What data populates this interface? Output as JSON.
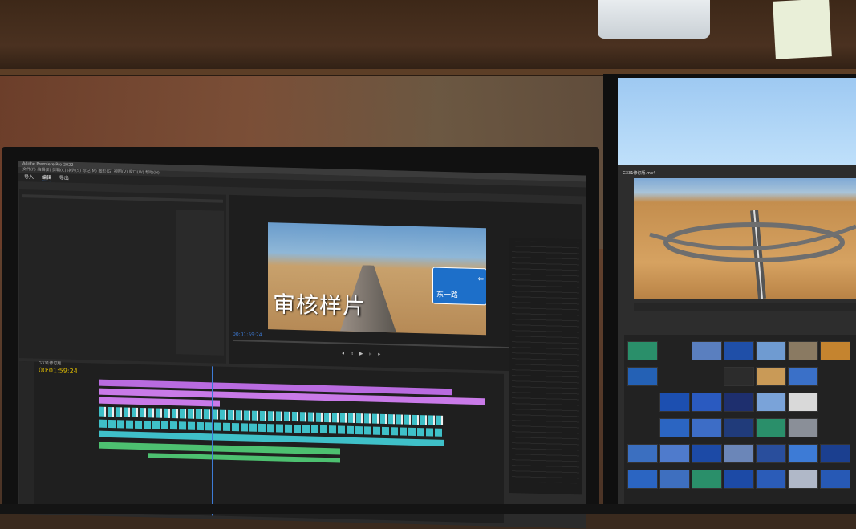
{
  "scene": {
    "left_monitor": {
      "title_bar": "Adobe Premiere Pro 2022",
      "menu": "文件(F)  编辑(E)  剪辑(C)  序列(S)  标记(M)  图形(G)  视图(V)  窗口(W)  帮助(H)",
      "workspace_tabs": [
        "导入",
        "编辑",
        "导出"
      ],
      "program_monitor": {
        "caption": "审核样片",
        "sign_text": "东一路",
        "timecode": "00:01:59:24"
      },
      "timeline": {
        "sequence_name": "G331修订版",
        "timecode": "00:01:59:24"
      }
    },
    "right_monitor": {
      "caption_bar": "G331修订版.mp4"
    }
  },
  "colors": {
    "video_purple": "#b96be0",
    "video_cyan": "#3fc0c8",
    "audio_green": "#4dc070",
    "accent_blue": "#3d7bd6",
    "timecode_yellow": "#e6c200"
  }
}
